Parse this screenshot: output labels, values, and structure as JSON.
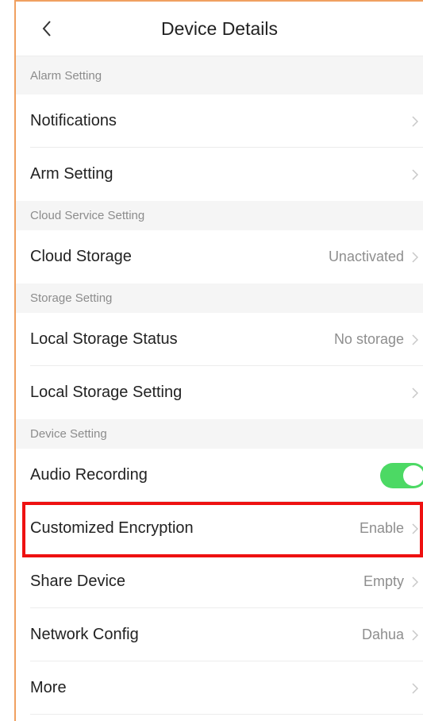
{
  "header": {
    "title": "Device Details",
    "back_icon": "chevron-left-icon"
  },
  "sections": {
    "alarm": "Alarm Setting",
    "cloud": "Cloud Service Setting",
    "storage": "Storage Setting",
    "device": "Device Setting"
  },
  "rows": {
    "notifications": {
      "label": "Notifications"
    },
    "arm": {
      "label": "Arm Setting"
    },
    "cloud_storage": {
      "label": "Cloud Storage",
      "value": "Unactivated"
    },
    "local_status": {
      "label": "Local Storage Status",
      "value": "No storage"
    },
    "local_setting": {
      "label": "Local Storage Setting"
    },
    "audio": {
      "label": "Audio Recording",
      "enabled": true
    },
    "encryption": {
      "label": "Customized Encryption",
      "value": "Enable"
    },
    "share": {
      "label": "Share Device",
      "value": "Empty"
    },
    "network": {
      "label": "Network Config",
      "value": "Dahua"
    },
    "more": {
      "label": "More"
    }
  },
  "colors": {
    "toggle_on": "#4cd964",
    "highlight": "#ee1111",
    "frame_border": "#f0a060"
  }
}
